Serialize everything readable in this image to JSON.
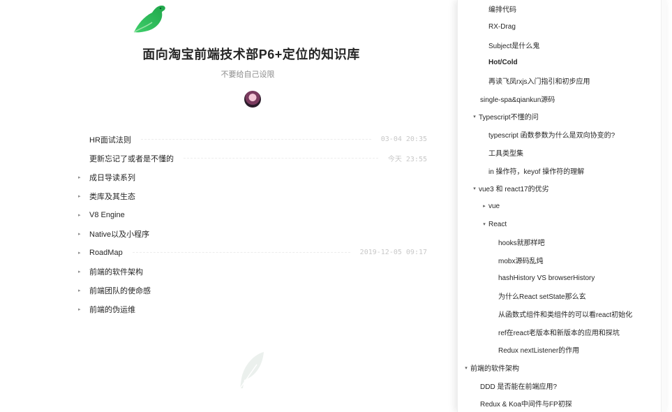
{
  "book": {
    "title": "面向淘宝前端技术部P6+定位的知识库",
    "subtitle": "不要给自己设限",
    "logo_icon": "green-bird-logo",
    "avatar_icon": "user-avatar",
    "watermark_icon": "feather-watermark"
  },
  "toc": [
    {
      "label": "HR面试法则",
      "date": "03-04 20:35",
      "has_arrow": false
    },
    {
      "label": "更新忘记了或者是不懂的",
      "date": "今天 23:55",
      "has_arrow": false
    },
    {
      "label": "成日导读系列",
      "date": "",
      "has_arrow": true
    },
    {
      "label": "类库及其生态",
      "date": "",
      "has_arrow": true
    },
    {
      "label": "V8 Engine",
      "date": "",
      "has_arrow": true
    },
    {
      "label": "Native以及小程序",
      "date": "",
      "has_arrow": true
    },
    {
      "label": "RoadMap",
      "date": "2019-12-05 09:17",
      "has_arrow": true
    },
    {
      "label": "前端的软件架构",
      "date": "",
      "has_arrow": true
    },
    {
      "label": "前端团队的使命感",
      "date": "",
      "has_arrow": true
    },
    {
      "label": "前端的伪运维",
      "date": "",
      "has_arrow": true
    }
  ],
  "panel": [
    {
      "label": "编排代码",
      "level": "lvl2",
      "caret": ""
    },
    {
      "label": "RX-Drag",
      "level": "lvl2",
      "caret": ""
    },
    {
      "label": "Subject是什么鬼",
      "level": "lvl2",
      "caret": ""
    },
    {
      "label": "Hot/Cold",
      "level": "lvl2",
      "caret": "",
      "bold": true
    },
    {
      "label": "再读飞凤rxjs入门指引和初步应用",
      "level": "lvl2",
      "caret": ""
    },
    {
      "label": "single-spa&qiankun源码",
      "level": "lvl1n",
      "caret": ""
    },
    {
      "label": "Typescript不懂的问",
      "level": "lvl1",
      "caret": "▾"
    },
    {
      "label": "typescript 函数参数为什么是双向协变的?",
      "level": "lvl2",
      "caret": ""
    },
    {
      "label": "工具类型集",
      "level": "lvl2",
      "caret": ""
    },
    {
      "label": "in 操作符，keyof 操作符的理解",
      "level": "lvl2",
      "caret": ""
    },
    {
      "label": "vue3 和 react17的优劣",
      "level": "lvl1",
      "caret": "▾"
    },
    {
      "label": "vue",
      "level": "lvl2c",
      "caret": "▸"
    },
    {
      "label": "React",
      "level": "lvl2c",
      "caret": "▾"
    },
    {
      "label": "hooks就那样吧",
      "level": "lvl3",
      "caret": ""
    },
    {
      "label": "mobx源码乱炖",
      "level": "lvl3",
      "caret": ""
    },
    {
      "label": "hashHistory VS browserHistory",
      "level": "lvl3",
      "caret": ""
    },
    {
      "label": "为什么React setState那么玄",
      "level": "lvl3",
      "caret": ""
    },
    {
      "label": "从函数式组件和类组件的可以看react初始化",
      "level": "lvl3",
      "caret": ""
    },
    {
      "label": "ref在react老版本和新版本的应用和探坑",
      "level": "lvl3",
      "caret": ""
    },
    {
      "label": "Redux nextListener的作用",
      "level": "lvl3",
      "caret": ""
    },
    {
      "label": "前端的软件架构",
      "level": "lvl0",
      "caret": "▾"
    },
    {
      "label": "DDD 是否能在前端应用?",
      "level": "lvl1n",
      "caret": ""
    },
    {
      "label": "Redux & Koa中间件与FP初探",
      "level": "lvl1n",
      "caret": ""
    }
  ]
}
